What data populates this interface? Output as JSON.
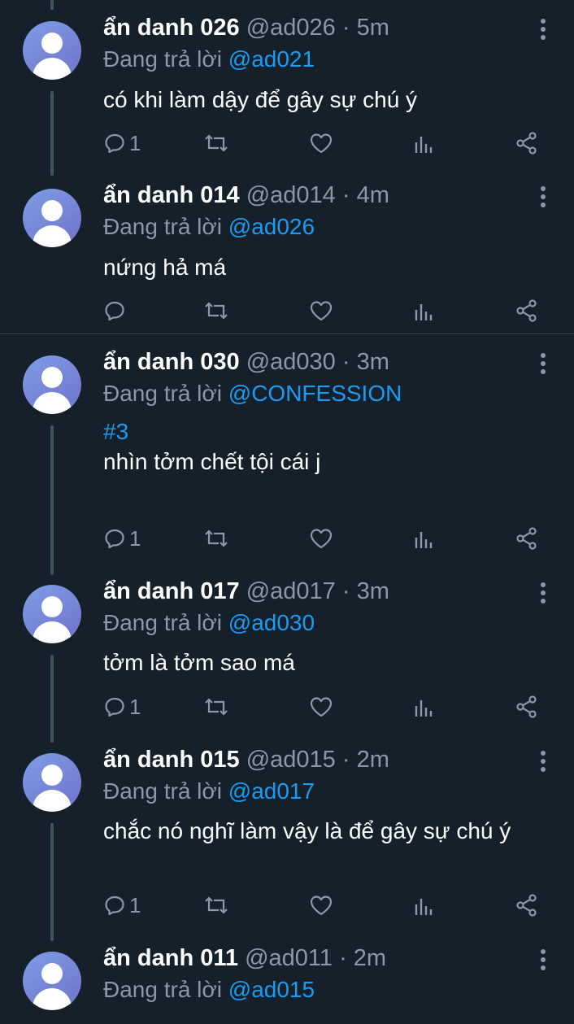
{
  "reply_prefix": "Đang trả lời",
  "colors": {
    "background": "#15202b",
    "accent": "#1d9bf0",
    "muted": "#8b98a5",
    "thread_line": "#3d5466"
  },
  "tweets": [
    {
      "name": "ẩn danh 026",
      "handle": "@ad026",
      "time": "5m",
      "reply_to": "@ad021",
      "hashtag": "",
      "text": "có khi làm dậy để gây sự chú ý",
      "reply_count": "1"
    },
    {
      "name": "ẩn danh 014",
      "handle": "@ad014",
      "time": "4m",
      "reply_to": "@ad026",
      "hashtag": "",
      "text": "nứng hả má",
      "reply_count": ""
    },
    {
      "name": "ẩn danh 030",
      "handle": "@ad030",
      "time": "3m",
      "reply_to": "@CONFESSION",
      "hashtag": "#3",
      "text": "nhìn tởm chết tội cái j",
      "reply_count": "1"
    },
    {
      "name": "ẩn danh 017",
      "handle": "@ad017",
      "time": "3m",
      "reply_to": "@ad030",
      "hashtag": "",
      "text": "tởm là tởm sao má",
      "reply_count": "1"
    },
    {
      "name": "ẩn danh 015",
      "handle": "@ad015",
      "time": "2m",
      "reply_to": "@ad017",
      "hashtag": "",
      "text": "chắc nó nghĩ làm vậy là để gây sự chú ý",
      "reply_count": "1"
    },
    {
      "name": "ẩn danh 011",
      "handle": "@ad011",
      "time": "2m",
      "reply_to": "@ad015",
      "hashtag": "",
      "text": "",
      "reply_count": ""
    }
  ]
}
